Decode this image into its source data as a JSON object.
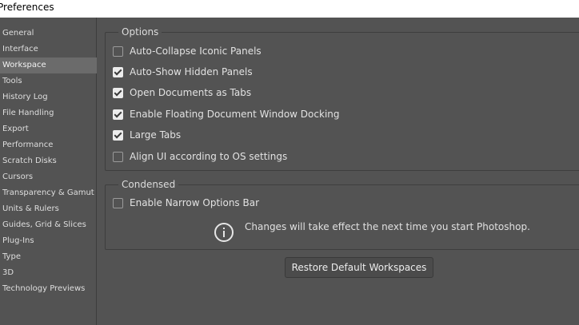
{
  "window": {
    "title": "Preferences"
  },
  "sidebar": {
    "items": [
      "General",
      "Interface",
      "Workspace",
      "Tools",
      "History Log",
      "File Handling",
      "Export",
      "Performance",
      "Scratch Disks",
      "Cursors",
      "Transparency & Gamut",
      "Units & Rulers",
      "Guides, Grid & Slices",
      "Plug-Ins",
      "Type",
      "3D",
      "Technology Previews"
    ],
    "selected": "Workspace"
  },
  "options": {
    "title": "Options",
    "items": [
      {
        "label": "Auto-Collapse Iconic Panels",
        "checked": false
      },
      {
        "label": "Auto-Show Hidden Panels",
        "checked": true
      },
      {
        "label": "Open Documents as Tabs",
        "checked": true
      },
      {
        "label": "Enable Floating Document Window Docking",
        "checked": true
      },
      {
        "label": "Large Tabs",
        "checked": true
      },
      {
        "label": "Align UI according to OS settings",
        "checked": false
      }
    ]
  },
  "condensed": {
    "title": "Condensed",
    "items": [
      {
        "label": "Enable Narrow Options Bar",
        "checked": false
      }
    ],
    "info_text": "Changes will take effect the next time you start Photoshop."
  },
  "restore_button": {
    "label": "Restore Default Workspaces"
  }
}
